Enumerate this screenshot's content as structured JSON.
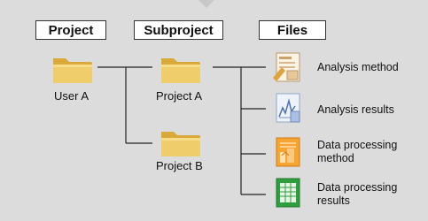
{
  "headers": {
    "project": "Project",
    "subproject": "Subproject",
    "files": "Files"
  },
  "nodes": {
    "user_a": "User A",
    "project_a": "Project A",
    "project_b": "Project B"
  },
  "files": [
    {
      "label": "Analysis method",
      "icon": "analysis-method-icon",
      "color": "#e6c89a"
    },
    {
      "label": "Analysis results",
      "icon": "analysis-results-icon",
      "color": "#a9bfe3"
    },
    {
      "label": "Data processing method",
      "icon": "data-processing-method-icon",
      "color": "#f59a1e"
    },
    {
      "label": "Data processing results",
      "icon": "data-processing-results-icon",
      "color": "#2e9e3e"
    }
  ],
  "colors": {
    "background": "#dcdcdc",
    "panel": "#ffffff",
    "folder": "#e8c05a",
    "connector": "#222222"
  }
}
